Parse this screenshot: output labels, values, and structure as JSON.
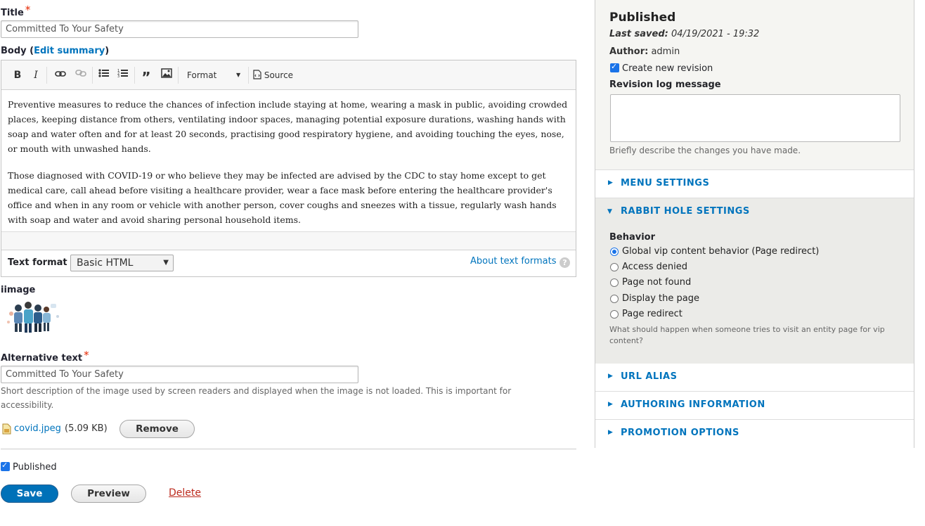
{
  "title_field": {
    "label": "Title",
    "value": "Committed To Your Safety"
  },
  "body_field": {
    "label": "Body (",
    "edit_summary": "Edit summary",
    "close": ")"
  },
  "toolbar": {
    "format_label": "Format",
    "source_label": "Source"
  },
  "body_content": {
    "p1": "Preventive measures to reduce the chances of infection include staying at home, wearing a mask in public, avoiding crowded places, keeping distance from others, ventilating indoor spaces, managing potential exposure durations, washing hands with soap and water often and for at least 20 seconds, practising good respiratory hygiene, and avoiding touching the eyes, nose, or mouth with unwashed hands.",
    "p2": "Those diagnosed with COVID-19 or who believe they may be infected are advised by the CDC to stay home except to get medical care, call ahead before visiting a healthcare provider, wear a face mask before entering the healthcare provider's office and when in any room or vehicle with another person, cover coughs and sneezes with a tissue, regularly wash hands with soap and water and avoid sharing personal household items."
  },
  "text_format": {
    "label": "Text format",
    "selected": "Basic HTML",
    "about": "About text formats"
  },
  "image_field": {
    "label": "iimage"
  },
  "alt_text": {
    "label": "Alternative text",
    "value": "Committed To Your Safety",
    "help": "Short description of the image used by screen readers and displayed when the image is not loaded. This is important for accessibility."
  },
  "file": {
    "name": "covid.jpeg",
    "size": "(5.09 KB)",
    "remove_label": "Remove"
  },
  "published": {
    "label": "Published",
    "checked": true
  },
  "actions": {
    "save": "Save",
    "preview": "Preview",
    "delete": "Delete"
  },
  "sidebar": {
    "status": "Published",
    "last_saved_label": "Last saved:",
    "last_saved_value": "04/19/2021 - 19:32",
    "author_label": "Author:",
    "author_value": "admin",
    "create_revision": "Create new revision",
    "revision_log_label": "Revision log message",
    "revision_help": "Briefly describe the changes you have made.",
    "menu_settings": "MENU SETTINGS",
    "rabbit_hole": {
      "title": "RABBIT HOLE SETTINGS",
      "behavior_label": "Behavior",
      "options": [
        "Global vip content behavior (Page redirect)",
        "Access denied",
        "Page not found",
        "Display the page",
        "Page redirect"
      ],
      "selected_index": 0,
      "help": "What should happen when someone tries to visit an entity page for vip content?"
    },
    "url_alias": "URL ALIAS",
    "authoring_info": "AUTHORING INFORMATION",
    "promotion_options": "PROMOTION OPTIONS"
  },
  "colors": {
    "link": "#0074bd",
    "primary_button": "#0071b8",
    "required": "#e62600",
    "delete": "#bc2b1e"
  }
}
